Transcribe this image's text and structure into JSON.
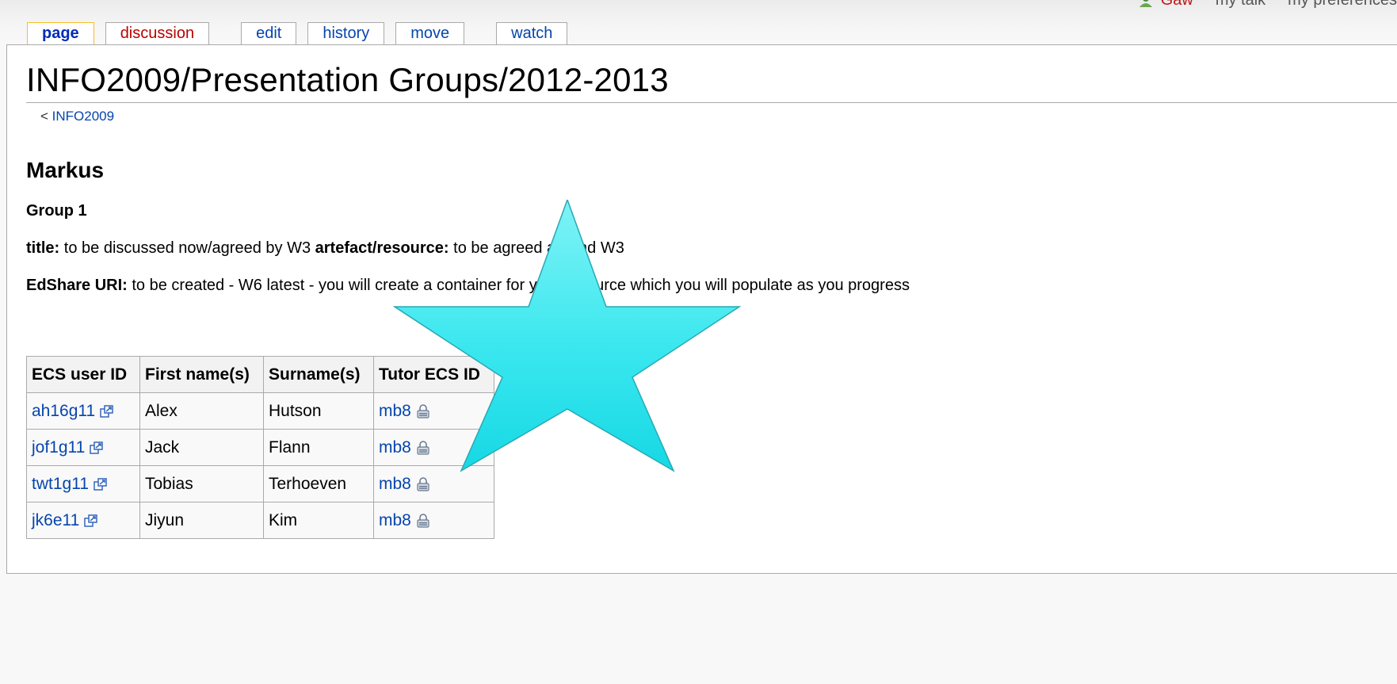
{
  "personal_tools": {
    "user": "Gaw",
    "talk": "my talk",
    "preferences": "my preferences"
  },
  "tabs": [
    {
      "label": "page",
      "selected": true
    },
    {
      "label": "discussion",
      "selected": false
    },
    {
      "label": "edit",
      "selected": false
    },
    {
      "label": "history",
      "selected": false
    },
    {
      "label": "move",
      "selected": false
    },
    {
      "label": "watch",
      "selected": false
    }
  ],
  "page": {
    "title": "INFO2009/Presentation Groups/2012-2013",
    "subpages_prefix": "< ",
    "subpages_link": "INFO2009",
    "heading": "Markus",
    "subheading": "Group 1",
    "line1": {
      "title_label": "title:",
      "title_text": " to be discussed now/agreed by W3 ",
      "artefact_label": "artefact/resource:",
      "artefact_text": " to be agreed around W3"
    },
    "line2": {
      "label": "EdShare URI:",
      "text": " to be created - W6 latest - you will create a container for your resource which you will populate as you progress"
    }
  },
  "table": {
    "headers": [
      "ECS user ID",
      "First name(s)",
      "Surname(s)",
      "Tutor ECS ID"
    ],
    "rows": [
      {
        "id": "ah16g11",
        "first": "Alex",
        "surname": "Hutson",
        "tutor": "mb8"
      },
      {
        "id": "jof1g11",
        "first": "Jack",
        "surname": "Flann",
        "tutor": "mb8"
      },
      {
        "id": "twt1g11",
        "first": "Tobias",
        "surname": "Terhoeven",
        "tutor": "mb8"
      },
      {
        "id": "jk6e11",
        "first": "Jiyun",
        "surname": "Kim",
        "tutor": "mb8"
      }
    ]
  },
  "overlay": {
    "shape": "star-icon",
    "color": "#36e6ee"
  },
  "colors": {
    "link": "#0645ad",
    "new_link": "#ba0000",
    "selected_tab_border": "#fabd23"
  }
}
